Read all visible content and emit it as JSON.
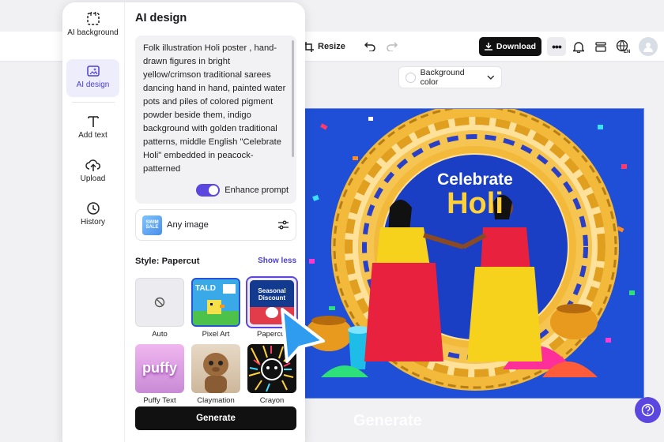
{
  "toolbar": {
    "resize_label": "Resize",
    "download_label": "Download",
    "more_label": "•••",
    "background_color_label": "Background color"
  },
  "rail": {
    "items": [
      {
        "label": "AI background",
        "icon": "dashed-frame-icon"
      },
      {
        "label": "AI design",
        "icon": "sparkle-image-icon",
        "active": true
      },
      {
        "label": "Add text",
        "icon": "text-t-icon"
      },
      {
        "label": "Upload",
        "icon": "cloud-upload-icon"
      },
      {
        "label": "History",
        "icon": "clock-icon"
      }
    ]
  },
  "panel": {
    "title": "AI design",
    "prompt": "Folk illustration Holi poster , hand-drawn figures in bright yellow/crimson traditional sarees dancing hand in hand, painted water pots and piles of colored pigment powder beside them, indigo background with golden traditional patterns, middle English \"Celebrate Holi\" embedded in peacock-patterned",
    "enhance_label": "Enhance prompt",
    "enhance_on": true,
    "image_label": "Any image",
    "image_thumb_text": "SWIM SALE",
    "style_label": "Style: Papercut",
    "show_less_label": "Show less",
    "styles": [
      {
        "name": "Auto"
      },
      {
        "name": "Pixel Art",
        "thumb_text": "TALD"
      },
      {
        "name": "Papercut",
        "thumb_text": "Seasonal Discount",
        "selected": true
      },
      {
        "name": "Puffy Text",
        "thumb_text": "puffy"
      },
      {
        "name": "Claymation"
      },
      {
        "name": "Crayon"
      }
    ],
    "generate_label": "Generate"
  },
  "poster": {
    "line1": "Celebrate",
    "line2": "Holi"
  },
  "ghost_generate_label": "Generate",
  "colors": {
    "accent": "#5B47E0",
    "poster_bg": "#1F4FD6",
    "gold": "#F2B93B",
    "crimson": "#E8213F",
    "yellow": "#FFD23C"
  }
}
